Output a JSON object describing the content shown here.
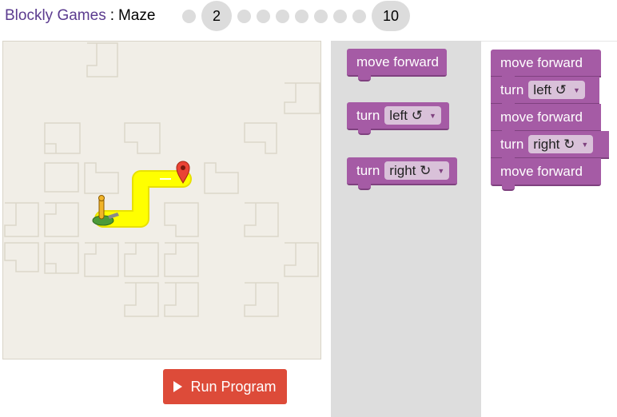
{
  "header": {
    "site_link": "Blockly Games",
    "separator": ":",
    "game_name": "Maze"
  },
  "levels": {
    "current": "2",
    "last": "10",
    "dots_before": 1,
    "dots_after": 7
  },
  "run_button": {
    "label": "Run Program",
    "color": "#dd4b39"
  },
  "toolbox": {
    "blocks": [
      {
        "type": "move",
        "label": "move forward"
      },
      {
        "type": "turn",
        "label": "turn",
        "option": "left ↺"
      },
      {
        "type": "turn",
        "label": "turn",
        "option": "right ↻"
      }
    ]
  },
  "workspace": {
    "blocks": [
      {
        "type": "move",
        "label": "move forward"
      },
      {
        "type": "turn",
        "label": "turn",
        "option": "left ↺"
      },
      {
        "type": "move",
        "label": "move forward"
      },
      {
        "type": "turn",
        "label": "turn",
        "option": "right ↻"
      },
      {
        "type": "move",
        "label": "move forward"
      }
    ]
  },
  "colors": {
    "block": "#a55ba5",
    "maze_bg": "#f1eee7",
    "path": "#ffff00",
    "accent_title": "#5b3b8f"
  }
}
